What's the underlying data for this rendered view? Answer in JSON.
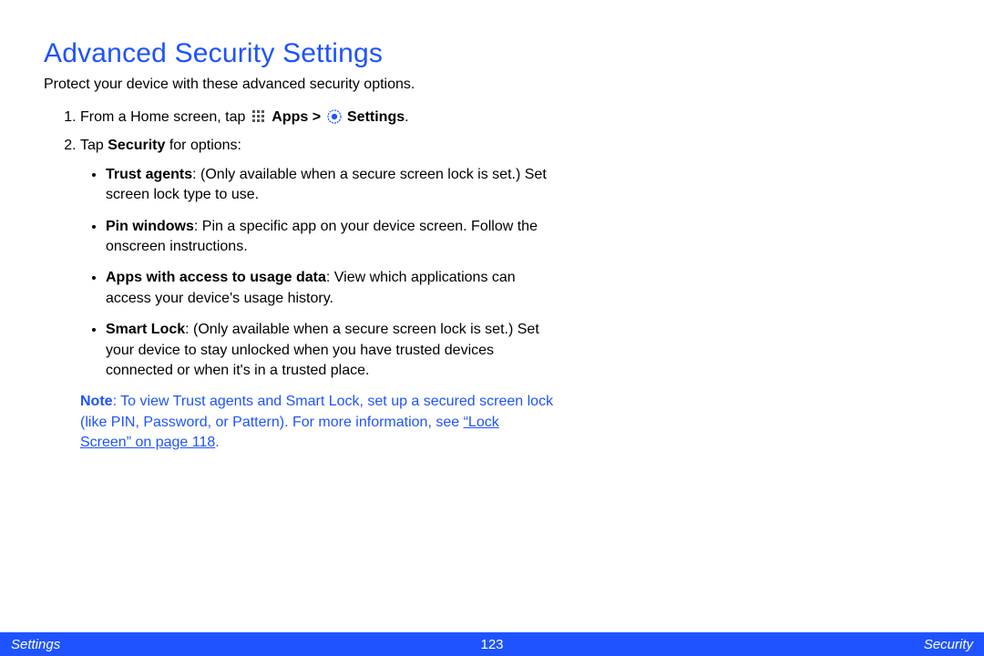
{
  "title": "Advanced Security Settings",
  "intro": "Protect your device with these advanced security options.",
  "step1": {
    "prefix": "From a Home screen, tap ",
    "apps": "Apps",
    "gt": " > ",
    "settings": "Settings",
    "period": "."
  },
  "step2": {
    "prefix": "Tap ",
    "bold": "Security",
    "suffix": " for options:"
  },
  "options": [
    {
      "label": "Trust agents",
      "text": ": (Only available when a secure screen lock is set.) Set screen lock type to use."
    },
    {
      "label": "Pin windows",
      "text": ": Pin a specific app on your device screen. Follow the onscreen instructions."
    },
    {
      "label": "Apps with access to usage data",
      "text": ": View which applications can access your device's usage history."
    },
    {
      "label": "Smart Lock",
      "text": ": (Only available when a secure screen lock is set.) Set your device to stay unlocked when you have trusted devices connected or when it's in a trusted place."
    }
  ],
  "note": {
    "label": "Note",
    "body": ": To view Trust agents and Smart Lock, set up a secured screen lock (like PIN, Password, or Pattern). For more information, see ",
    "link": "“Lock Screen” on page 118",
    "period": "."
  },
  "footer": {
    "left": "Settings",
    "center": "123",
    "right": "Security"
  },
  "icons": {
    "apps": "apps-grid-icon",
    "settings": "settings-gear-icon"
  }
}
